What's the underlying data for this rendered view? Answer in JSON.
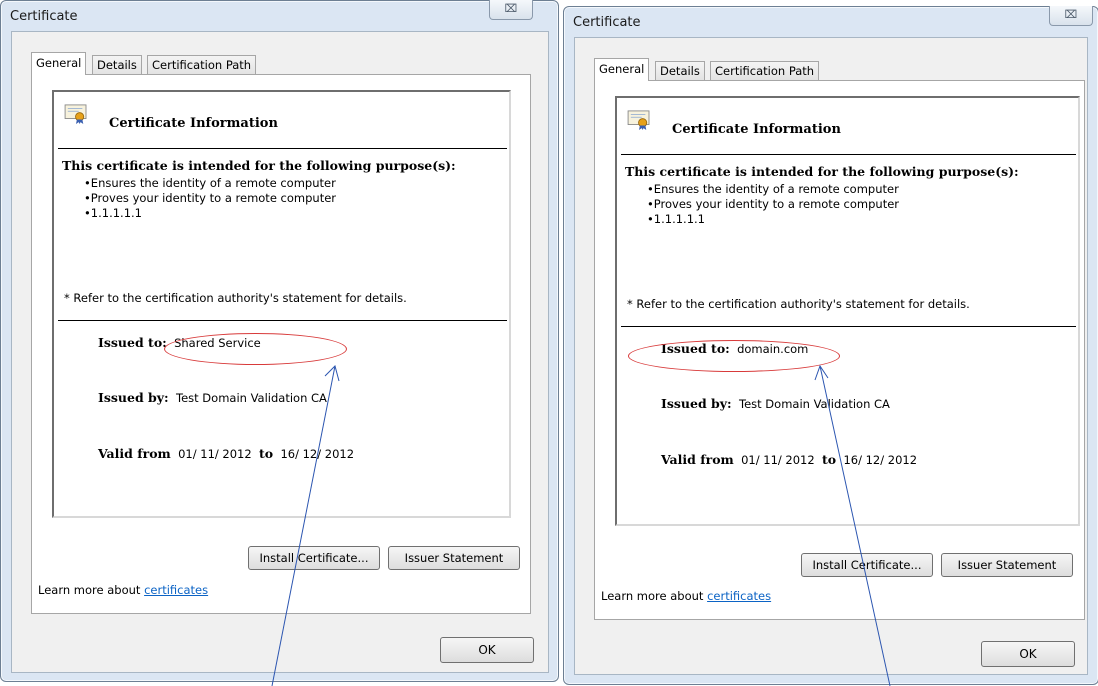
{
  "dialogs": [
    {
      "title": "Certificate",
      "close_glyph": "⌧",
      "tabs": [
        "General",
        "Details",
        "Certification Path"
      ],
      "info_header": "Certificate Information",
      "purpose_heading": "This certificate is intended for the following purpose(s):",
      "purposes": [
        "Ensures the identity of a remote computer",
        "Proves your identity to a remote computer",
        "1.1.1.1.1"
      ],
      "refer_note": "* Refer to the certification authority's statement for details.",
      "issued_to_label": "Issued to:",
      "issued_to_value": "Shared Service",
      "issued_by_label": "Issued by:",
      "issued_by_value": "Test Domain Validation CA",
      "valid_from_label": "Valid from",
      "valid_from_value": "01/ 11/ 2012",
      "valid_to_label": "to",
      "valid_to_value": "16/ 12/ 2012",
      "install_button": "Install Certificate...",
      "issuer_statement_button": "Issuer Statement",
      "learn_more_text": "Learn more about",
      "learn_more_link": "certificates",
      "ok_button": "OK"
    },
    {
      "title": "Certificate",
      "close_glyph": "⌧",
      "tabs": [
        "General",
        "Details",
        "Certification Path"
      ],
      "info_header": "Certificate Information",
      "purpose_heading": "This certificate is intended for the following purpose(s):",
      "purposes": [
        "Ensures the identity of a remote computer",
        "Proves your identity to a remote computer",
        "1.1.1.1.1"
      ],
      "refer_note": "* Refer to the certification authority's statement for details.",
      "issued_to_label": "Issued to:",
      "issued_to_value": "domain.com",
      "issued_by_label": "Issued by:",
      "issued_by_value": "Test Domain Validation CA",
      "valid_from_label": "Valid from",
      "valid_from_value": "01/ 11/ 2012",
      "valid_to_label": "to",
      "valid_to_value": "16/ 12/ 2012",
      "install_button": "Install Certificate...",
      "issuer_statement_button": "Issuer Statement",
      "learn_more_text": "Learn more about",
      "learn_more_link": "certificates",
      "ok_button": "OK"
    }
  ],
  "annotation_colors": {
    "highlight_ellipse": "#d83a3a",
    "arrow": "#2b55b0"
  },
  "icons": [
    "certificate-icon",
    "close-icon"
  ]
}
